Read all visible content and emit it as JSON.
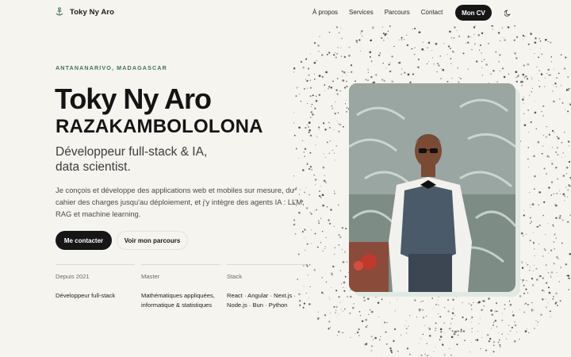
{
  "nav": {
    "brand": "Toky Ny Aro",
    "links": [
      "À propos",
      "Services",
      "Parcours",
      "Contact"
    ],
    "cv_button": "Mon CV"
  },
  "hero": {
    "location": "ANTANANARIVO, MADAGASCAR",
    "first_name": "Toky Ny Aro",
    "last_name": "RAZAKAMBOLOLONA",
    "role_line1": "Développeur full-stack & IA,",
    "role_line2": "data scientist.",
    "description": "Je conçois et développe des applications web et mobiles sur mesure, du cahier des charges jusqu'au déploiement, et j'y intègre des agents IA : LLM, RAG et machine learning.",
    "contact_button": "Me contacter",
    "parcours_button": "Voir mon parcours"
  },
  "stats": [
    {
      "label": "Depuis 2021",
      "value": "Développeur full-stack"
    },
    {
      "label": "Master",
      "value": "Mathématiques appliquées, informatique & statistiques"
    },
    {
      "label": "Stack",
      "value": "React · Angular · Next.js · Node.js · Bun · Python"
    }
  ],
  "colors": {
    "background": "#f6f4ef",
    "accent_green": "#3f7454",
    "button_dark": "#161616"
  },
  "icons": {
    "brand": "anchor-icon",
    "theme": "moon-icon"
  }
}
